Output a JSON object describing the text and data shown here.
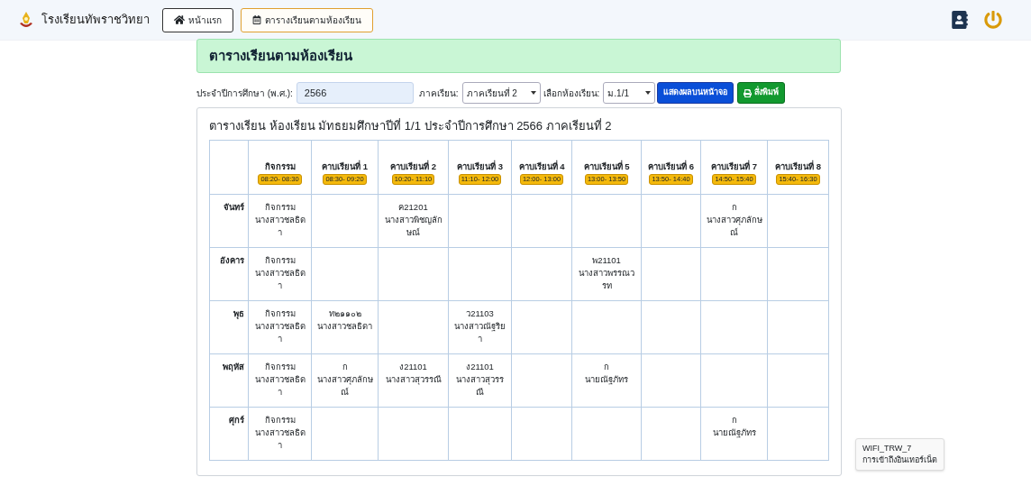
{
  "navbar": {
    "brand": "โรงเรียนทัพราชวิทยา",
    "links": [
      {
        "label": "หน้าแรก",
        "kind": "home",
        "selected": false
      },
      {
        "label": "ตารางเรียนตามห้องเรียน",
        "kind": "calendar",
        "selected": true
      }
    ]
  },
  "page_title": "ตารางเรียนตามห้องเรียน",
  "filters": {
    "year_label": "ประจำปีการศึกษา (พ.ศ.):",
    "year_value": "2566",
    "term_label": "ภาคเรียน:",
    "term_value": "ภาคเรียนที่ 2",
    "room_label": "เลือกห้องเรียน:",
    "room_value": "ม.1/1",
    "show_button": "แสดงผลบนหน้าจอ",
    "print_button": "สั่งพิมพ์"
  },
  "schedule": {
    "title": "ตารางเรียน ห้องเรียน มัทธยมศึกษาปีที่ 1/1 ประจำปีการศึกษา 2566 ภาคเรียนที่ 2",
    "columns": [
      {
        "label": "กิจกรรม",
        "time": "08:20- 08:30"
      },
      {
        "label": "คาบเรียนที่ 1",
        "time": "08:30- 09:20"
      },
      {
        "label": "คาบเรียนที่ 2",
        "time": "10:20- 11:10"
      },
      {
        "label": "คาบเรียนที่ 3",
        "time": "11:10- 12:00"
      },
      {
        "label": "คาบเรียนที่ 4",
        "time": "12:00- 13:00"
      },
      {
        "label": "คาบเรียนที่ 5",
        "time": "13:00- 13:50"
      },
      {
        "label": "คาบเรียนที่ 6",
        "time": "13:50- 14:40"
      },
      {
        "label": "คาบเรียนที่ 7",
        "time": "14:50- 15:40"
      },
      {
        "label": "คาบเรียนที่ 8",
        "time": "15:40- 16:30"
      }
    ],
    "rows": [
      {
        "day": "จันทร์",
        "cells": [
          [
            "กิจกรรม",
            "นางสาวชลธิดา"
          ],
          [],
          [
            "ค21201",
            "นางสาวพิชญลักษณ์"
          ],
          [],
          [],
          [],
          [],
          [
            "ก",
            "นางสาวศุภลักษณ์"
          ],
          []
        ]
      },
      {
        "day": "อังคาร",
        "cells": [
          [
            "กิจกรรม",
            "นางสาวชลธิดา"
          ],
          [],
          [],
          [],
          [],
          [
            "พ21101",
            "นางสาวพรรณวรท"
          ],
          [],
          [],
          []
        ]
      },
      {
        "day": "พุธ",
        "cells": [
          [
            "กิจกรรม",
            "นางสาวชลธิดา"
          ],
          [
            "ท๒๑๑๐๒",
            "นางสาวชลธิดา"
          ],
          [],
          [
            "ว21103",
            "นางสาวณัฐริยา"
          ],
          [],
          [],
          [],
          [],
          []
        ]
      },
      {
        "day": "พฤหัส",
        "cells": [
          [
            "กิจกรรม",
            "นางสาวชลธิดา"
          ],
          [
            "ก",
            "นางสาวศุภลักษณ์"
          ],
          [
            "ง21101",
            "นางสาวสุวรรณี"
          ],
          [
            "ง21101",
            "นางสาวสุวรรณี"
          ],
          [],
          [
            "ก",
            "นายณัฐภัทร"
          ],
          [],
          [],
          []
        ]
      },
      {
        "day": "ศุกร์",
        "cells": [
          [
            "กิจกรรม",
            "นางสาวชลธิดา"
          ],
          [],
          [],
          [],
          [],
          [],
          [],
          [
            "ก",
            "นายณัฐภัทร"
          ],
          []
        ]
      }
    ]
  },
  "toast": {
    "network": "WIFI_TRW_7",
    "status": "การเข้าถึงอินเทอร์เน็ต"
  }
}
